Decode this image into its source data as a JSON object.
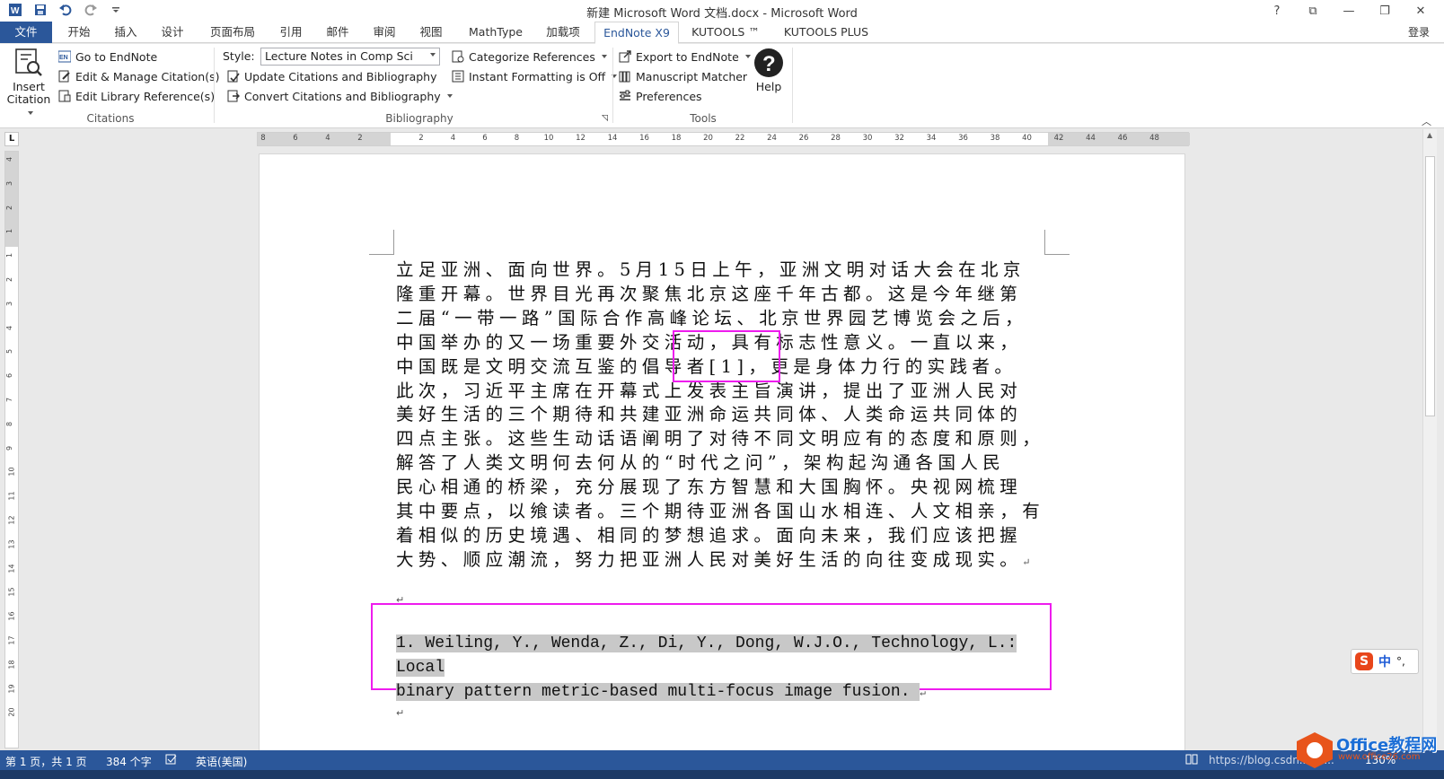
{
  "window": {
    "title": "新建 Microsoft Word 文档.docx - Microsoft Word",
    "controls": [
      "?",
      "⧉",
      "—",
      "❐",
      "✕"
    ]
  },
  "tabs": {
    "file": "文件",
    "items": [
      "开始",
      "插入",
      "设计",
      "页面布局",
      "引用",
      "邮件",
      "审阅",
      "视图",
      "MathType",
      "加载项",
      "EndNote X9",
      "KUTOOLS ™",
      "KUTOOLS PLUS"
    ],
    "active": "EndNote X9",
    "login": "登录"
  },
  "ribbon": {
    "citations": {
      "insert_label_1": "Insert",
      "insert_label_2": "Citation",
      "go_to": "Go to EndNote",
      "edit_manage": "Edit & Manage Citation(s)",
      "edit_library": "Edit Library Reference(s)",
      "group_label": "Citations"
    },
    "bibliography": {
      "style_label": "Style:",
      "style_value": "Lecture Notes in Comp Sci",
      "update": "Update Citations and Bibliography",
      "convert": "Convert Citations and Bibliography",
      "categorize": "Categorize References",
      "instant": "Instant Formatting is Off",
      "group_label": "Bibliography"
    },
    "tools": {
      "export": "Export to EndNote",
      "matcher": "Manuscript Matcher",
      "preferences": "Preferences",
      "group_label": "Tools",
      "help": "Help"
    }
  },
  "ruler": {
    "tab_selector": "L",
    "h_numbers": [
      "8",
      "6",
      "4",
      "2",
      "2",
      "4",
      "6",
      "8",
      "10",
      "12",
      "14",
      "16",
      "18",
      "20",
      "22",
      "24",
      "26",
      "28",
      "30",
      "32",
      "34",
      "36",
      "38",
      "40",
      "42",
      "44",
      "46",
      "48"
    ],
    "v_numbers": [
      "4",
      "3",
      "2",
      "1",
      "1",
      "2",
      "3",
      "4",
      "5",
      "6",
      "7",
      "8",
      "9",
      "10",
      "11",
      "12",
      "13",
      "14",
      "15",
      "16",
      "17",
      "18",
      "19",
      "20"
    ]
  },
  "document": {
    "lines": [
      "立足亚洲、面向世界。5月15日上午，亚洲文明对话大会在北京",
      "隆重开幕。世界目光再次聚焦北京这座千年古都。这是今年继第",
      "二届“一带一路”国际合作高峰论坛、北京世界园艺博览会之后，",
      "中国举办的又一场重要外交活动，具有标志性意义。一直以来，",
      "中国既是文明交流互鉴的倡导者[1]，更是身体力行的实践者。",
      "此次，习近平主席在开幕式上发表主旨演讲，提出了亚洲人民对",
      "美好生活的三个期待和共建亚洲命运共同体、人类命运共同体的",
      "四点主张。这些生动话语阐明了对待不同文明应有的态度和原则，",
      "解答了人类文明何去何从的“时代之问”，架构起沟通各国人民",
      "民心相通的桥梁，充分展现了东方智慧和大国胸怀。央视网梳理",
      "其中要点，以飨读者。三个期待亚洲各国山水相连、人文相亲，有",
      "着相似的历史境遇、相同的梦想追求。面向未来，我们应该把握",
      "大势、顺应潮流，努力把亚洲人民对美好生活的向往变成现实。"
    ],
    "para_mark": "↵",
    "reference_line_1": "1.  Weiling, Y., Wenda, Z., Di, Y., Dong, W.J.O., Technology, L.: Local",
    "reference_line_2": "binary pattern metric-based multi-focus image fusion. "
  },
  "ime": {
    "logo": "S",
    "mode": "中",
    "punct": "°,"
  },
  "status": {
    "page": "第 1 页，共 1 页",
    "words": "384 个字",
    "language": "英语(美国)",
    "url": "https://blog.csdn.net/...",
    "zoom": "130%"
  },
  "watermark": {
    "name": "Office教程网",
    "url": "www.office26.com"
  },
  "colors": {
    "accent": "#2b579a",
    "highlight": "#ee1cee",
    "ref_bg": "#c8c8c8"
  }
}
